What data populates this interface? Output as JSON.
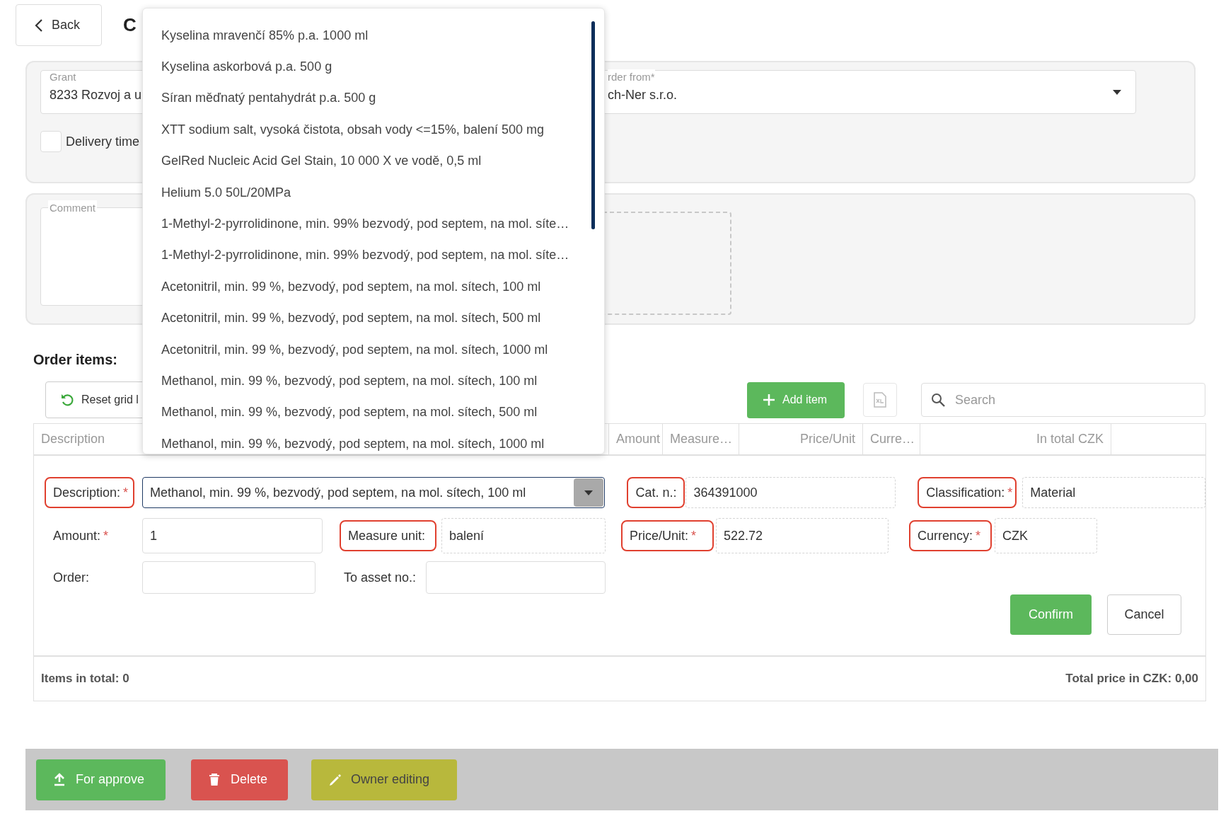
{
  "header": {
    "back_button": "Back",
    "title": "C"
  },
  "order_form": {
    "grant": {
      "label": "Grant",
      "value": "8233 Rozvoj a u"
    },
    "order_from": {
      "label": "rder from*",
      "value": "ch-Ner s.r.o."
    },
    "delivery_time": {
      "label": "Delivery time",
      "checked": false
    }
  },
  "comment": {
    "label": "Comment"
  },
  "order_items": {
    "title": "Order items:",
    "reset_button": "Reset grid l",
    "add_button": "Add item",
    "search": {
      "placeholder": "Search"
    },
    "columns": [
      "Description",
      "Amount",
      "Measure…",
      "Price/Unit",
      "Curre…",
      "In total CZK"
    ]
  },
  "item_editor": {
    "fields": [
      {
        "label": "Description:",
        "required_mark": "*",
        "highlighted": true,
        "kind": "combo",
        "readonly": false,
        "value": "Methanol, min. 99 %, bezvodý, pod septem, na mol. sítech, 100 ml"
      },
      {
        "label": "Cat. n.:",
        "highlighted": true,
        "kind": "text",
        "readonly": true,
        "value": "364391000"
      },
      {
        "label": "Classification:",
        "required_mark": "*",
        "highlighted": true,
        "kind": "text",
        "readonly": true,
        "value": "Material"
      },
      {
        "label": "Amount:",
        "required_mark": "*",
        "highlighted": false,
        "kind": "text",
        "readonly": false,
        "value": "1"
      },
      {
        "label": "Measure unit:",
        "highlighted": true,
        "kind": "text",
        "readonly": true,
        "value": "balení"
      },
      {
        "label": "Price/Unit:",
        "required_mark": "*",
        "highlighted": true,
        "kind": "text",
        "readonly": true,
        "value": "522.72"
      },
      {
        "label": "Currency:",
        "required_mark": "*",
        "highlighted": true,
        "kind": "text",
        "readonly": true,
        "value": "CZK"
      },
      {
        "label": "Order:",
        "highlighted": false,
        "kind": "text",
        "readonly": false
      },
      {
        "label": "To asset no.:",
        "highlighted": false,
        "kind": "text",
        "readonly": false
      }
    ],
    "buttons": [
      {
        "label": "Confirm",
        "kind": "primary"
      },
      {
        "label": "Cancel",
        "kind": "secondary"
      }
    ]
  },
  "totals": {
    "items": "Items in total: 0",
    "price": "Total price in CZK: 0,00"
  },
  "dropdown": {
    "options": [
      "Kyselina mravenčí 85% p.a. 1000 ml",
      "Kyselina askorbová p.a. 500 g",
      "Síran měďnatý pentahydrát p.a. 500 g",
      "XTT sodium salt, vysoká čistota, obsah vody <=15%, balení 500 mg",
      "GelRed Nucleic Acid Gel Stain, 10 000 X ve vodě, 0,5 ml",
      "Helium 5.0 50L/20MPa",
      "1-Methyl-2-pyrrolidinone, min. 99% bezvodý, pod septem, na mol. síte…",
      "1-Methyl-2-pyrrolidinone, min. 99% bezvodý, pod septem, na mol. síte…",
      "Acetonitril, min. 99 %, bezvodý, pod septem, na mol. sítech, 100 ml",
      "Acetonitril, min. 99 %, bezvodý, pod septem, na mol. sítech, 500 ml",
      "Acetonitril, min. 99 %, bezvodý, pod septem, na mol. sítech, 1000 ml",
      "Methanol, min. 99 %, bezvodý, pod septem, na mol. sítech, 100 ml",
      "Methanol, min. 99 %, bezvodý, pod septem, na mol. sítech, 500 ml",
      "Methanol, min. 99 %, bezvodý, pod septem, na mol. sítech, 1000 ml"
    ]
  },
  "actions": [
    {
      "label": "For approve",
      "kind": "approve"
    },
    {
      "label": "Delete",
      "kind": "delete"
    },
    {
      "label": "Owner editing",
      "kind": "edit"
    }
  ]
}
